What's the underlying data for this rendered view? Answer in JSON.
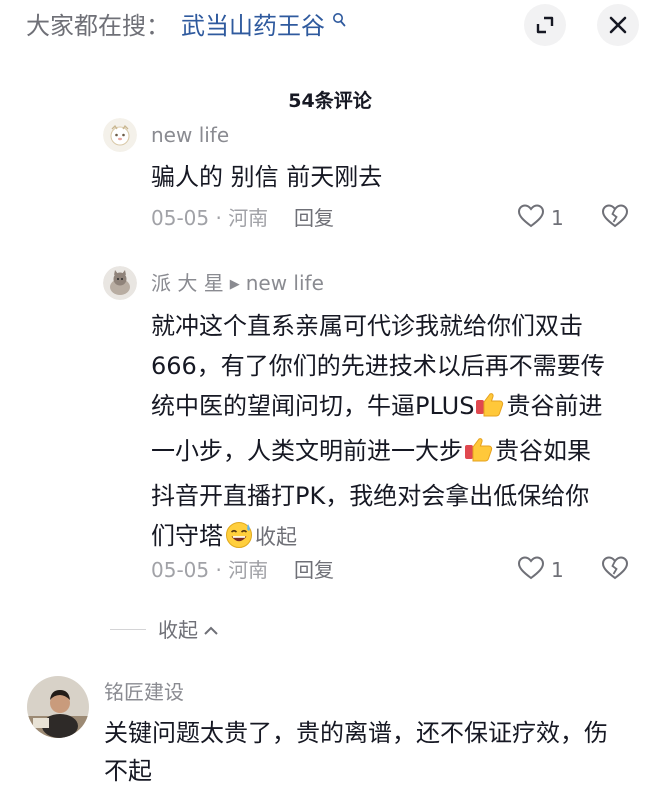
{
  "search": {
    "prefix": "大家都在搜：",
    "term": "武当山药王谷"
  },
  "header": {
    "comment_count": "54条评论"
  },
  "comments": [
    {
      "user": "new life",
      "text": "骗人的 别信 前天刚去",
      "date": "05-05 · 河南",
      "reply_label": "回复",
      "likes": "1"
    },
    {
      "user": "派 大 星",
      "reply_to": "new life",
      "lines": [
        "就冲这个直系亲属可代诊我就给你们双击",
        "666，有了你们的先进技术以后再不需要传",
        "统中医的望闻问切，牛逼PLUS",
        "贵谷前进",
        "一小步，人类文明前进一大步",
        "贵谷如果",
        "抖音开直播打PK，我绝对会拿出低保给你",
        "们守塔"
      ],
      "collapse_label": "收起",
      "date": "05-05 · 河南",
      "reply_label": "回复",
      "likes": "1"
    },
    {
      "user": "铭匠建设",
      "text": "关键问题太贵了，贵的离谱，还不保证疗效，伤",
      "text_cut": "不起"
    }
  ],
  "thread": {
    "collapse_label": "收起"
  }
}
